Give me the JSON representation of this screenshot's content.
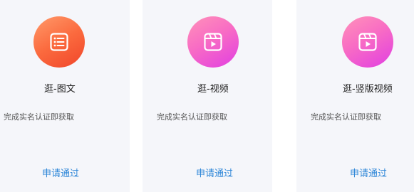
{
  "cards": [
    {
      "title": "逛-图文",
      "description": "完成实名认证即获取",
      "action_label": "申请通过",
      "icon": "list-document-icon",
      "accent_colors": [
        "#ff9a6a",
        "#f0452a"
      ]
    },
    {
      "title": "逛-视频",
      "description": "完成实名认证即获取",
      "action_label": "申请通过",
      "icon": "video-play-icon",
      "accent_colors": [
        "#ff92b9",
        "#e13ee2"
      ]
    },
    {
      "title": "逛-竖版视频",
      "description": "完成实名认证即获取",
      "action_label": "申请通过",
      "icon": "video-play-icon",
      "accent_colors": [
        "#ff92b9",
        "#e13ee2"
      ]
    }
  ],
  "link_color": "#2f87d8"
}
